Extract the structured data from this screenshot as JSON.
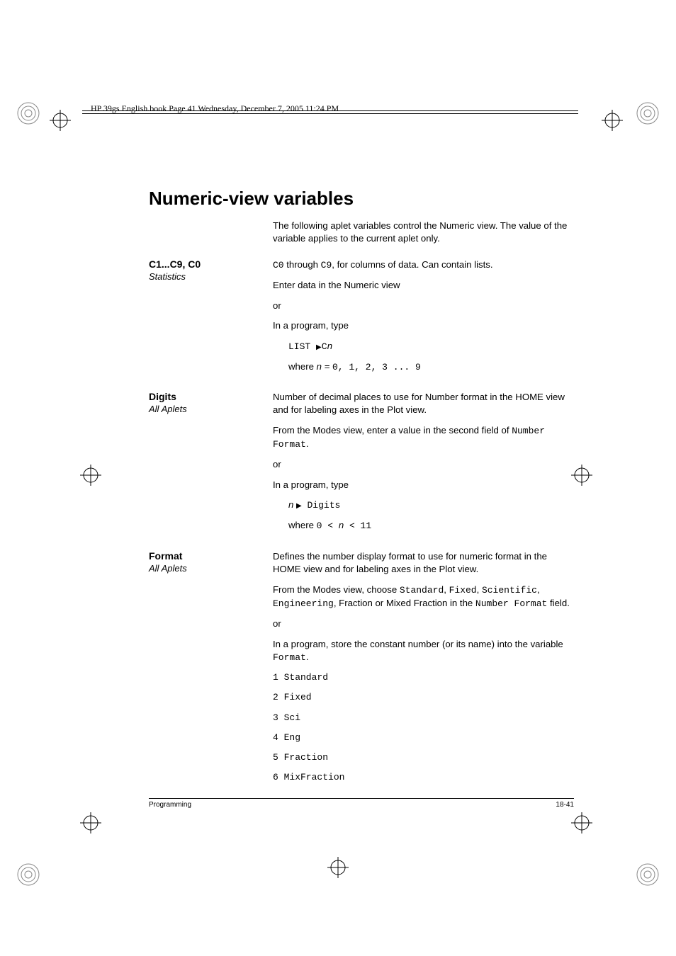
{
  "header": "HP 39gs English.book  Page 41  Wednesday, December 7, 2005  11:24 PM",
  "title": "Numeric-view variables",
  "intro1": "The following aplet variables control the Numeric view. The value of the variable applies to the current aplet only.",
  "c1c9": {
    "term": "C1...C9, C0",
    "cat": "Statistics",
    "p1a": "C0",
    "p1b": " through ",
    "p1c": "C9",
    "p1d": ", for columns of data. Can contain lists.",
    "p2": "Enter data in the Numeric view",
    "p3": "or",
    "p4": "In a program, type",
    "code1a": "LIST ",
    "code1b": "C",
    "code1c": "n",
    "w1": "where ",
    "w1b": "n = ",
    "w1c": "0, 1, 2, 3 ... 9"
  },
  "digits": {
    "term": "Digits",
    "cat": "All Aplets",
    "p1": "Number of decimal places to use for Number format in the HOME view and for labeling axes in the Plot view.",
    "p2a": "From the Modes view, enter a value in the second field of ",
    "p2b": "Number Format",
    "p2c": ".",
    "p3": "or",
    "p4": "In a program, type",
    "code1a": "n ",
    "code1b": " Digits",
    "w1": "where ",
    "w1b": "0 < ",
    "w1c": "n",
    "w1d": " < 11"
  },
  "format": {
    "term": "Format",
    "cat": "All Aplets",
    "p1": "Defines the number display format to use for numeric format in the HOME view and for labeling axes in the Plot view.",
    "p2a": "From the Modes view, choose ",
    "p2b": "Standard",
    "p2c": ", ",
    "p2d": "Fixed",
    "p2e": ", ",
    "p2f": "Scientific",
    "p2g": ", ",
    "p2h": "Engineering",
    "p2i": ", Fraction or Mixed Fraction in the ",
    "p2j": "Number Format",
    "p2k": " field.",
    "p3": "or",
    "p4a": "In a program, store the constant number (or its name) into the variable ",
    "p4b": "Format",
    "p4c": ".",
    "opts": [
      "1 Standard",
      "2 Fixed",
      "3 Sci",
      "4 Eng",
      "5 Fraction",
      "6 MixFraction"
    ]
  },
  "footer": {
    "left": "Programming",
    "right": "18-41"
  }
}
